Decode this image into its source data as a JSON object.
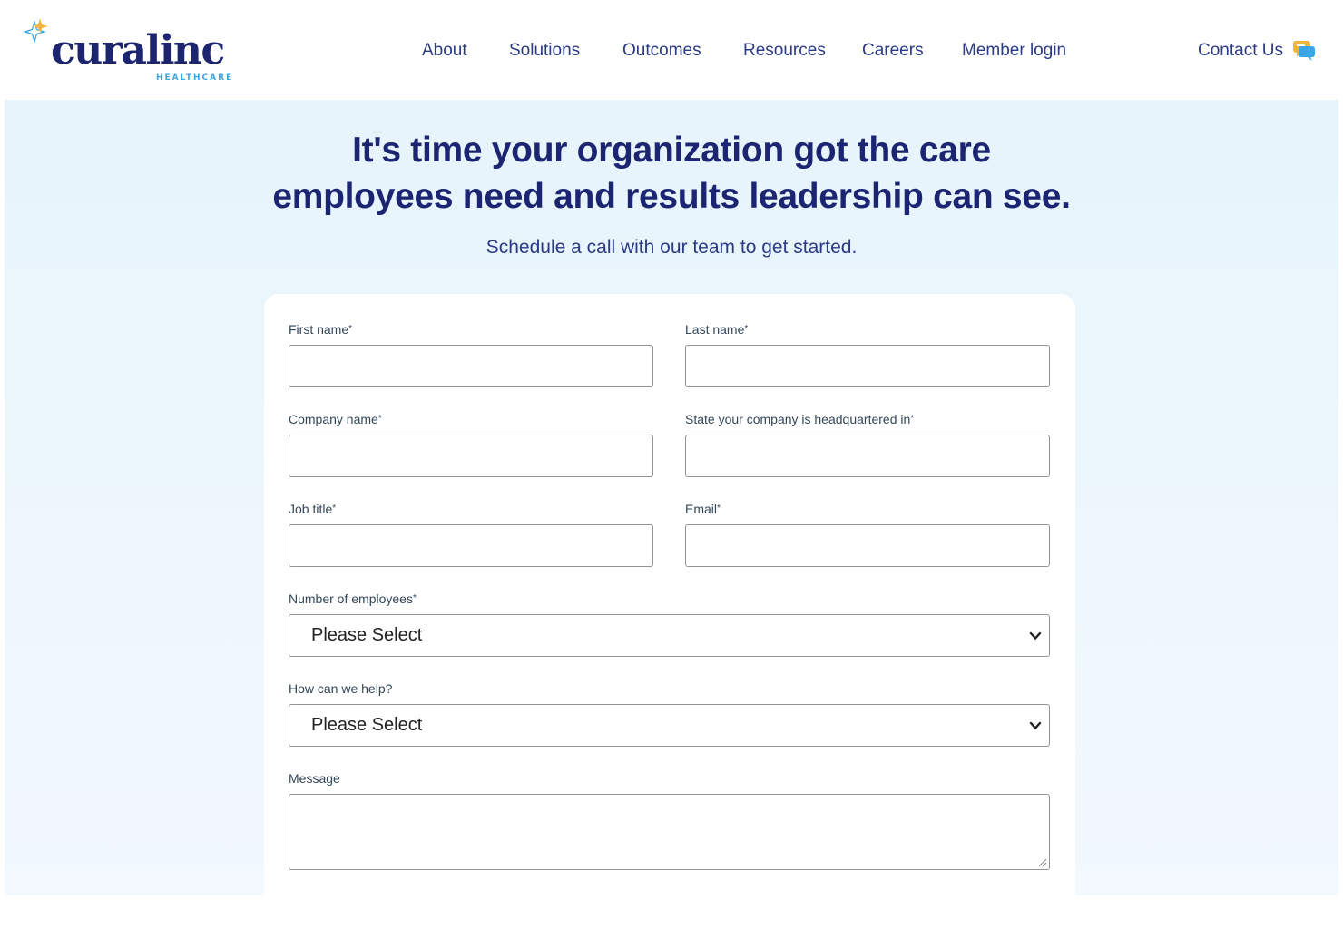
{
  "brand": {
    "name": "curalinc",
    "subtitle": "HEALTHCARE",
    "colors": {
      "navy": "#1c2572",
      "sky": "#3aa6e6",
      "gold": "#f2b43a"
    }
  },
  "nav": {
    "items": [
      {
        "label": "About"
      },
      {
        "label": "Solutions"
      },
      {
        "label": "Outcomes"
      },
      {
        "label": "Resources"
      },
      {
        "label": "Careers"
      },
      {
        "label": "Member login"
      }
    ],
    "contact": {
      "label": "Contact Us",
      "icon": "chat-bubble-icon"
    }
  },
  "hero": {
    "headline_line1": "It's time your organization got the care",
    "headline_line2": "employees need and results leadership can see.",
    "subline": "Schedule a call with our team to get started."
  },
  "form": {
    "required_mark": "*",
    "first_name": {
      "label": "First name",
      "value": ""
    },
    "last_name": {
      "label": "Last name",
      "value": ""
    },
    "company_name": {
      "label": "Company name",
      "value": ""
    },
    "state": {
      "label": "State your company is headquartered in",
      "value": ""
    },
    "job_title": {
      "label": "Job title",
      "value": ""
    },
    "email": {
      "label": "Email",
      "value": ""
    },
    "employees": {
      "label": "Number of employees",
      "selected": "Please Select"
    },
    "help": {
      "label": "How can we help?",
      "selected": "Please Select"
    },
    "message": {
      "label": "Message",
      "value": ""
    }
  }
}
